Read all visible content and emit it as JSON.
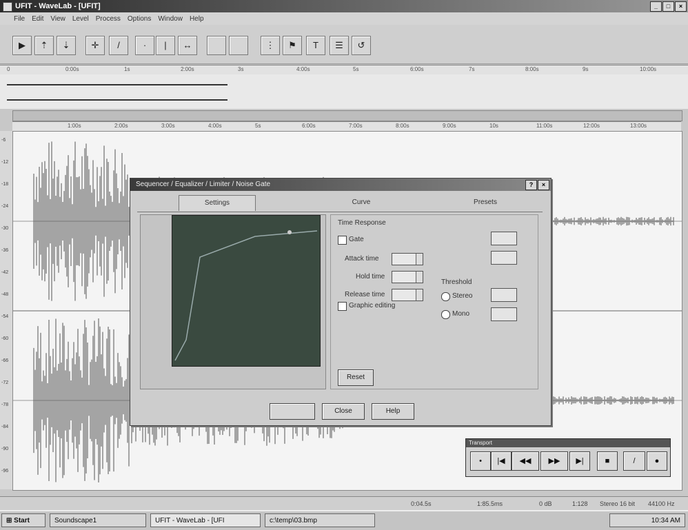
{
  "window": {
    "title": "UFIT - WaveLab - [UFIT]"
  },
  "menu": [
    "File",
    "Edit",
    "View",
    "Level",
    "Process",
    "Options",
    "Window",
    "Help"
  ],
  "ruler_top": [
    "0",
    "0:00s",
    "1s",
    "2:00s",
    "3s",
    "4:00s",
    "5s",
    "6:00s",
    "7s",
    "8:00s",
    "9s",
    "10:00s"
  ],
  "ruler_main": [
    "1:00s",
    "2:00s",
    "3:00s",
    "4:00s",
    "5s",
    "6:00s",
    "7:00s",
    "8:00s",
    "9:00s",
    "10s",
    "11:00s",
    "12:00s",
    "13:00s"
  ],
  "vruler_labels": [
    "-6",
    "-12",
    "-18",
    "-24",
    "-30",
    "-36",
    "-42",
    "-48",
    "-54",
    "-60",
    "-66",
    "-72",
    "-78",
    "-84",
    "-90",
    "-96"
  ],
  "dialog": {
    "title": "Sequencer / Equalizer / Limiter / Noise Gate",
    "tabs": [
      "Settings",
      "Curve",
      "Presets"
    ],
    "section_label": "Time Response",
    "checkbox_label": "Gate",
    "fields": [
      "Attack time",
      "Hold time",
      "Release time"
    ],
    "group_label": "Threshold",
    "radio_1": "Stereo",
    "radio_2": "Mono",
    "graphic_label": "Graphic editing",
    "reset_button": "Reset",
    "close_button": "Close",
    "help_button": "Help"
  },
  "transport": {
    "title": "Transport"
  },
  "status": {
    "pos": "0:04.5s",
    "len": "1:85.5ms",
    "db": "0 dB",
    "zoom": "1:128",
    "format": "Stereo 16 bit",
    "rate": "44100 Hz"
  },
  "taskbar": {
    "start": "Start",
    "items": [
      "Soundscape1",
      "UFIT - WaveLab - [UFI",
      "c:\\temp\\03.bmp"
    ],
    "clock": "10:34 AM"
  }
}
